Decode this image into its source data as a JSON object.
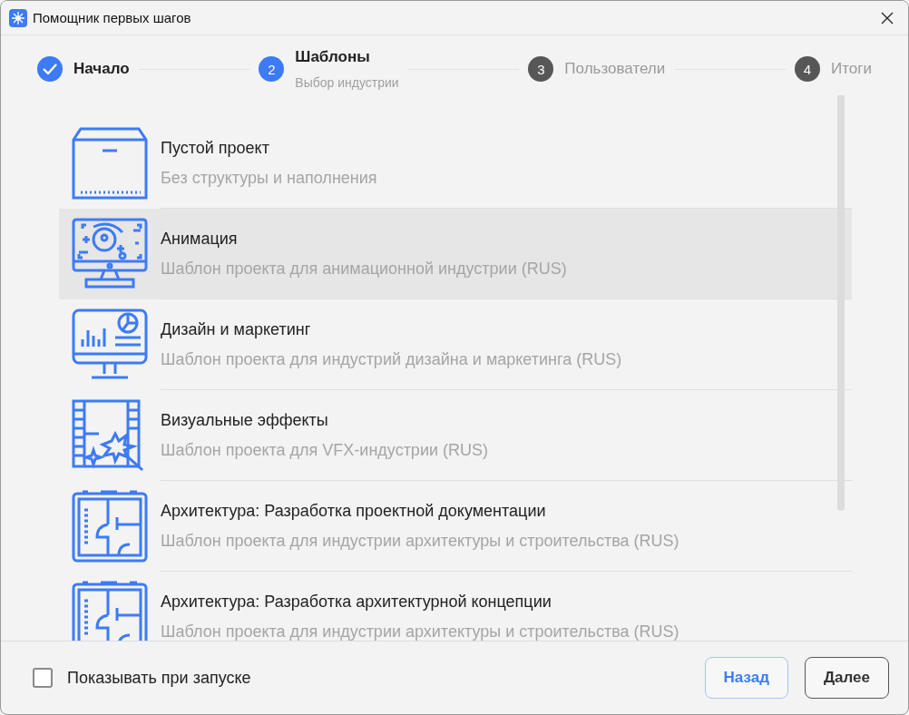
{
  "window": {
    "title": "Помощник первых шагов"
  },
  "steps": [
    {
      "label": "Начало",
      "completed": true,
      "active": false
    },
    {
      "number": "2",
      "label": "Шаблоны",
      "sublabel": "Выбор индустрии",
      "completed": false,
      "active": true
    },
    {
      "number": "3",
      "label": "Пользователи",
      "completed": false,
      "active": false
    },
    {
      "number": "4",
      "label": "Итоги",
      "completed": false,
      "active": false
    }
  ],
  "templates": [
    {
      "kind": "box",
      "title": "Пустой проект",
      "subtitle": "Без структуры и наполнения",
      "selected": false
    },
    {
      "kind": "animation",
      "title": "Анимация",
      "subtitle": "Шаблон проекта для анимационной индустрии (RUS)",
      "selected": true
    },
    {
      "kind": "design",
      "title": "Дизайн и маркетинг",
      "subtitle": "Шаблон проекта для индустрий дизайна и маркетинга (RUS)",
      "selected": false
    },
    {
      "kind": "vfx",
      "title": "Визуальные эффекты",
      "subtitle": "Шаблон проекта для VFX-индустрии (RUS)",
      "selected": false
    },
    {
      "kind": "architecture",
      "title": "Архитектура: Разработка проектной документации",
      "subtitle": "Шаблон проекта для индустрии архитектуры и строительства (RUS)",
      "selected": false
    },
    {
      "kind": "architecture",
      "title": "Архитектура: Разработка архитектурной концепции",
      "subtitle": "Шаблон проекта для индустрии архитектуры и строительства (RUS)",
      "selected": false
    }
  ],
  "footer": {
    "show_on_start": {
      "label": "Показывать при запуске",
      "checked": false
    },
    "buttons": [
      {
        "label": "Назад",
        "kind": "secondary"
      },
      {
        "label": "Далее",
        "kind": "primary"
      }
    ]
  }
}
